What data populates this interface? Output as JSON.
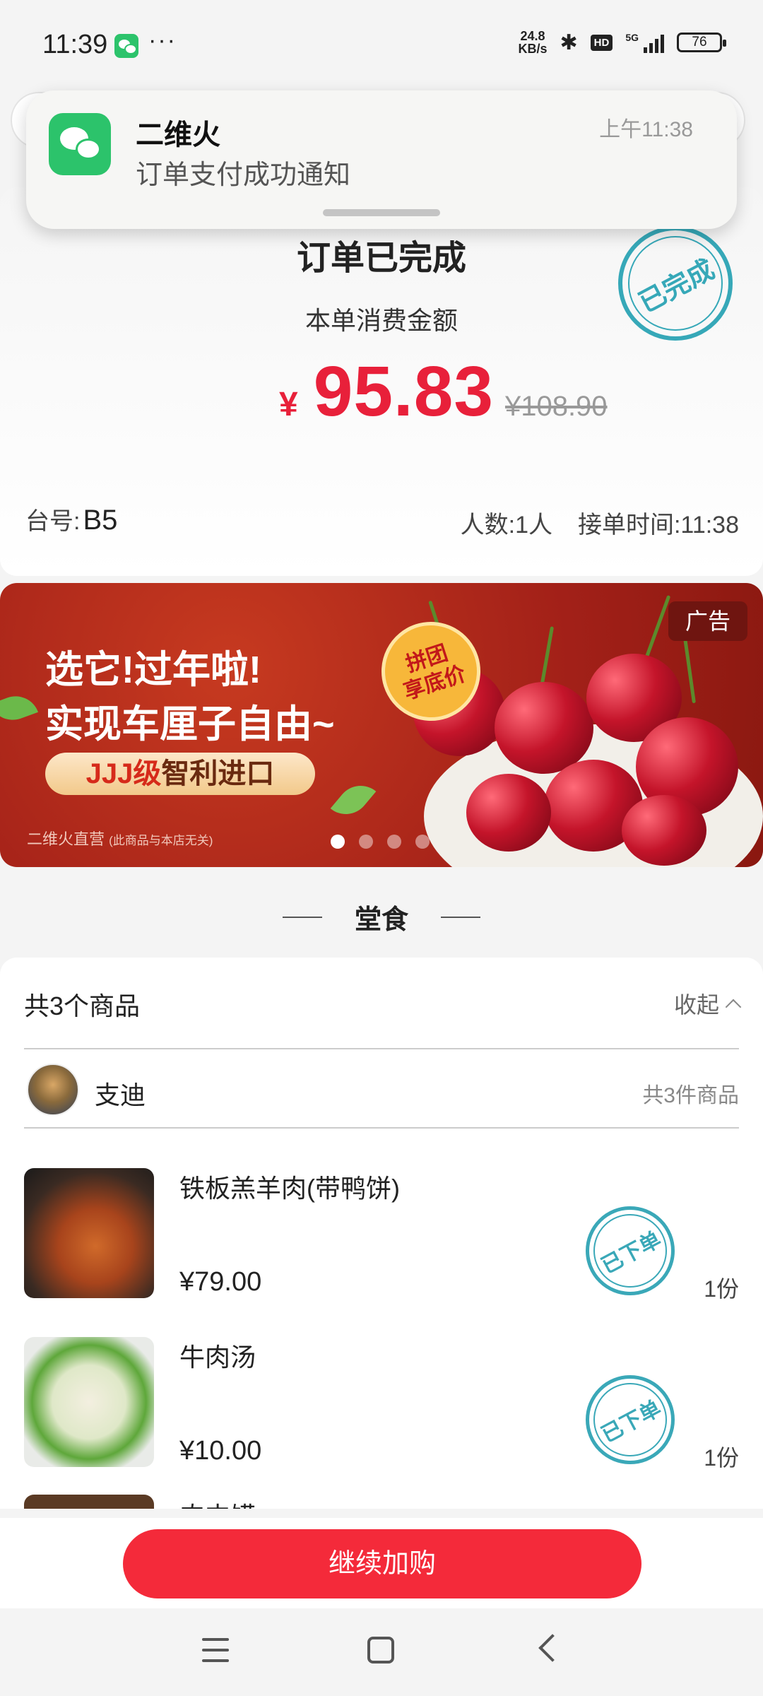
{
  "status_bar": {
    "time": "11:39",
    "more": "···",
    "net_speed_value": "24.8",
    "net_speed_unit": "KB/s",
    "hd": "HD",
    "network": "5G",
    "battery": "76"
  },
  "notification": {
    "app_name": "二维火",
    "message": "订单支付成功通知",
    "time": "上午11:38"
  },
  "order": {
    "title": "订单已完成",
    "subtitle": "本单消费金额",
    "currency": "¥",
    "amount": "95.83",
    "original_price": "¥108.90",
    "stamp": "已完成",
    "table_label": "台号:",
    "table_number": "B5",
    "people": "人数:1人",
    "order_time": "接单时间:11:38"
  },
  "ad": {
    "line1": "选它!过年啦!",
    "line2": "实现车厘子自由~",
    "pill_red": "JJJ级",
    "pill_rest": "智利进口",
    "badge_line1": "拼团",
    "badge_line2": "享底价",
    "tag": "广告",
    "source": "二维火直营",
    "source_note": "(此商品与本店无关)",
    "carousel_index": 1,
    "carousel_total": 4
  },
  "section": {
    "dine_in": "堂食"
  },
  "items_card": {
    "count_label": "共3个商品",
    "collapse_label": "收起",
    "person_name": "支迪",
    "person_count": "共3件商品",
    "items": [
      {
        "name": "铁板羔羊肉(带鸭饼)",
        "price": "¥79.00",
        "qty": "1份",
        "stamp": "已下单"
      },
      {
        "name": "牛肉汤",
        "price": "¥10.00",
        "qty": "1份",
        "stamp": "已下单"
      },
      {
        "name": "肉夹馍"
      }
    ]
  },
  "actions": {
    "continue": "继续加购"
  },
  "colors": {
    "accent_red": "#f42a3a",
    "price_red": "#e8203a",
    "stamp_teal": "#36a8b8",
    "wechat_green": "#2cc36b"
  }
}
